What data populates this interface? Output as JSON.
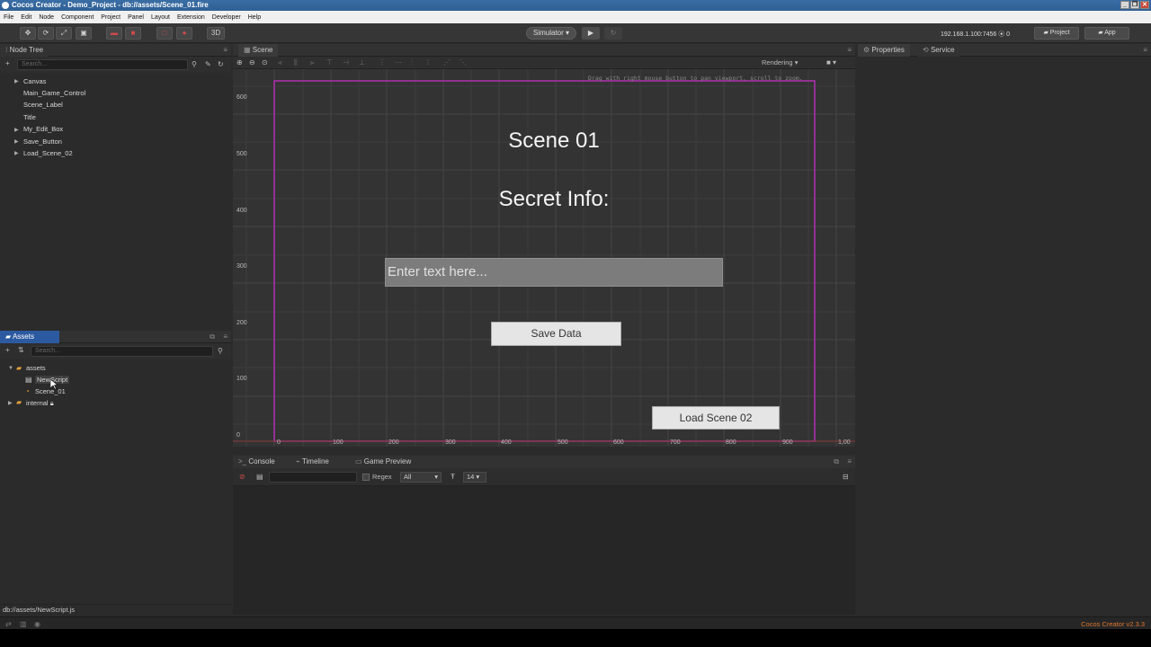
{
  "window": {
    "title": "Cocos Creator - Demo_Project - db://assets/Scene_01.fire"
  },
  "menu": [
    "File",
    "Edit",
    "Node",
    "Component",
    "Project",
    "Panel",
    "Layout",
    "Extension",
    "Developer",
    "Help"
  ],
  "toolbar": {
    "mode_3d": "3D",
    "simulator_label": "Simulator ▾",
    "play_icon": "▶",
    "ip_status": "192.168.1.100:7456 ⦿ 0",
    "project_label": "Project",
    "app_label": "App"
  },
  "node_tree": {
    "title": "Node Tree",
    "search_placeholder": "Search...",
    "items": [
      "Canvas",
      "Main_Game_Control",
      "Scene_Label",
      "Title",
      "My_Edit_Box",
      "Save_Button",
      "Load_Scene_02"
    ]
  },
  "assets": {
    "title": "Assets",
    "search_placeholder": "Search...",
    "root": "assets",
    "children": [
      "NewScript",
      "Scene_01"
    ],
    "internal": "internal",
    "path": "db://assets/NewScript.js"
  },
  "scene": {
    "tab": "Scene",
    "rendering": "Rendering",
    "hint": "Drag with right mouse button to pan viewport, scroll to zoom.",
    "y_ticks": [
      "600",
      "500",
      "400",
      "300",
      "200",
      "100",
      "0"
    ],
    "x_ticks": [
      "0",
      "100",
      "200",
      "300",
      "400",
      "500",
      "600",
      "700",
      "800",
      "900",
      "1,00"
    ],
    "title_text": "Scene 01",
    "secret_label": "Secret Info:",
    "editbox_placeholder": "Enter text here...",
    "save_button": "Save Data",
    "load_button": "Load Scene 02"
  },
  "console": {
    "tabs": [
      "Console",
      "Timeline",
      "Game Preview"
    ],
    "regex_label": "Regex",
    "filter_value": "All",
    "font_size": "14"
  },
  "properties": {
    "tab": "Properties",
    "service_tab": "Service"
  },
  "status": {
    "version": "Cocos Creator v2.3.3"
  },
  "colors": {
    "accent_blue": "#2c5aa0",
    "design_frame": "#b12fb1",
    "version_orange": "#e0752b"
  }
}
